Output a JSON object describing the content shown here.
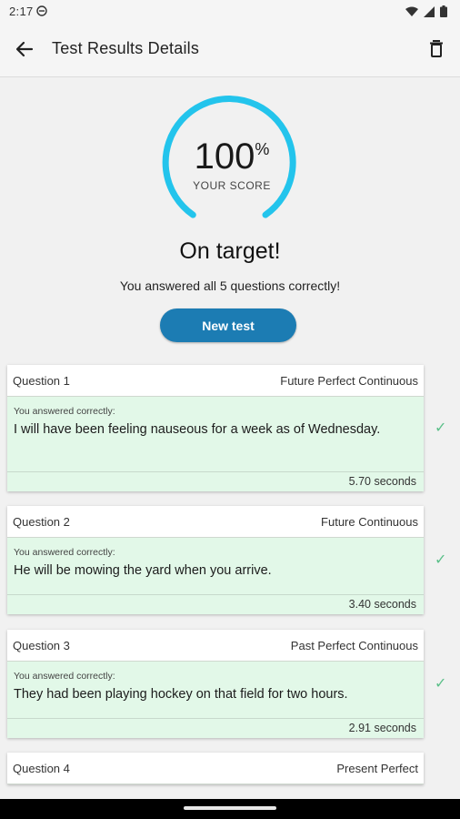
{
  "status": {
    "time": "2:17"
  },
  "header": {
    "title": "Test Results Details"
  },
  "score": {
    "value": "100",
    "unit": "%",
    "caption": "YOUR SCORE",
    "percent": 100
  },
  "result": {
    "title": "On target!",
    "subtitle": "You answered all 5 questions correctly!"
  },
  "new_test_label": "New test",
  "questions": [
    {
      "label": "Question 1",
      "tense": "Future Perfect Continuous",
      "caption": "You answered correctly:",
      "answer": "I will have been feeling nauseous for a week as of Wednesday.",
      "time": "5.70 seconds"
    },
    {
      "label": "Question 2",
      "tense": "Future Continuous",
      "caption": "You answered correctly:",
      "answer": "He will be mowing the yard when you arrive.",
      "time": "3.40 seconds"
    },
    {
      "label": "Question 3",
      "tense": "Past Perfect Continuous",
      "caption": "You answered correctly:",
      "answer": "They had been playing hockey on that field for two hours.",
      "time": "2.91 seconds"
    },
    {
      "label": "Question 4",
      "tense": "Present Perfect"
    }
  ],
  "check_mark": "✓",
  "colors": {
    "accent": "#1c7cb3",
    "ring": "#23c4ec",
    "correct_bg": "#e2f8e8",
    "check": "#5cc08a"
  },
  "icons": [
    "back-arrow-icon",
    "trash-icon",
    "check-icon",
    "wifi-icon",
    "signal-icon",
    "battery-icon",
    "dnd-icon"
  ]
}
